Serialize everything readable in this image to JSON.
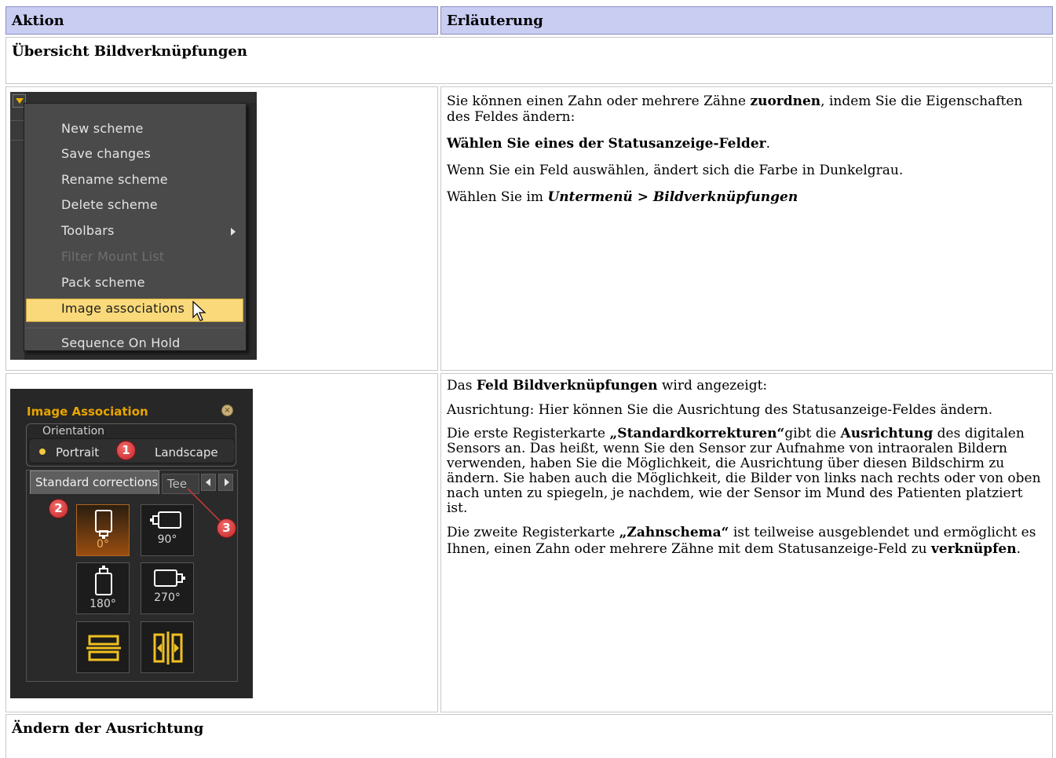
{
  "headers": {
    "action": "Aktion",
    "explanation": "Erläuterung"
  },
  "sections": {
    "overview": "Übersicht Bildverknüpfungen",
    "change_orientation": "Ändern der Ausrichtung"
  },
  "menu": {
    "items": [
      {
        "label": "New scheme",
        "disabled": false
      },
      {
        "label": "Save changes",
        "disabled": false
      },
      {
        "label": "Rename scheme",
        "disabled": false
      },
      {
        "label": "Delete scheme",
        "disabled": false
      },
      {
        "label": "Toolbars",
        "disabled": false,
        "submenu": true
      },
      {
        "label": "Filter Mount List",
        "disabled": true
      },
      {
        "label": "Pack scheme",
        "disabled": false
      },
      {
        "label": "Image associations",
        "disabled": false,
        "selected": true
      },
      {
        "label": "Sequence On Hold",
        "disabled": false
      }
    ]
  },
  "row1": {
    "p1_pre": "Sie können einen Zahn oder mehrere Zähne ",
    "p1_bold": "zuordnen",
    "p1_post": ", indem Sie die Eigenschaften des Feldes ändern:",
    "p2_bold": "Wählen Sie eines der Statusanzeige-Felder",
    "p2_post": ".",
    "p3": "Wenn Sie ein Feld auswählen, ändert sich die Farbe in Dunkelgrau.",
    "p4_pre": "Wählen Sie im ",
    "p4_bi1": "Untermenü",
    "p4_mid": " > ",
    "p4_bi2": "Bildverknüpfungen"
  },
  "panel": {
    "title": "Image Association",
    "close": "×",
    "orientation_label": "Orientation",
    "radio_portrait": "Portrait",
    "radio_landscape": "Landscape",
    "tab_standard": "Standard corrections",
    "tab_teeth": "Tee",
    "tiles": [
      "0°",
      "90°",
      "180°",
      "270°"
    ],
    "badges": [
      "1",
      "2",
      "3"
    ],
    "accent": "#e8a500"
  },
  "row2": {
    "p1_pre": "Das ",
    "p1_bold": "Feld Bildverknüpfungen",
    "p1_post": " wird angezeigt:",
    "p2": " Ausrichtung: Hier können Sie die Ausrichtung des Statusanzeige-Feldes ändern.",
    "p3_pre": " Die erste Registerkarte ",
    "p3_b1": "„Standardkorrekturen“",
    "p3_mid": "gibt die ",
    "p3_b2": "Ausrichtung",
    "p3_post": " des digitalen Sensors an.  Das heißt, wenn Sie den Sensor zur Aufnahme von intraoralen Bildern verwenden, haben Sie die Möglichkeit, die Ausrichtung über diesen Bildschirm zu ändern. Sie haben auch die Möglichkeit, die Bilder von links nach rechts oder von oben nach unten zu spiegeln, je nachdem, wie der Sensor im Mund des Patienten platziert ist.",
    "p4_pre": " Die zweite Registerkarte ",
    "p4_b1": "„Zahnschema“",
    "p4_mid": " ist teilweise ausgeblendet und ermöglicht es Ihnen, einen Zahn oder mehrere Zähne mit dem Statusanzeige-Feld zu ",
    "p4_b2": "verknüpfen",
    "p4_post": "."
  }
}
